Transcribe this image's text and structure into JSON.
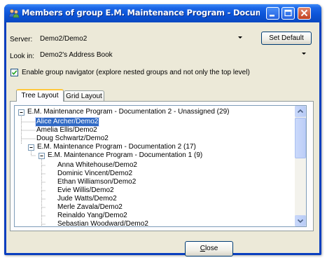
{
  "window": {
    "title": "Members of group E.M. Maintenance Program - Documentation...",
    "app_icon": "group-icon",
    "controls": [
      "minimize-icon",
      "maximize-icon",
      "close-icon"
    ]
  },
  "server": {
    "label": "Server:",
    "value": "Demo2/Demo2",
    "button": "Set Default"
  },
  "lookin": {
    "label": "Look in:",
    "value": "Demo2's Address Book"
  },
  "navigator": {
    "checked": true,
    "label": "Enable group navigator (explore nested groups and not only the top level)"
  },
  "tabs": [
    {
      "label": "Tree Layout",
      "active": true
    },
    {
      "label": "Grid Layout",
      "active": false
    }
  ],
  "tree": [
    {
      "label": "E.M. Maintenance Program - Documentation 2 - Unassigned (29)",
      "type": "group",
      "expanded": true
    },
    {
      "label": "Alice Archer/Demo2",
      "type": "person",
      "selected": true
    },
    {
      "label": "Amelia Ellis/Demo2",
      "type": "person"
    },
    {
      "label": "Doug Schwartz/Demo2",
      "type": "person"
    },
    {
      "label": "E.M. Maintenance Program - Documentation 2 (17)",
      "type": "group",
      "expanded": true
    },
    {
      "label": "E.M. Maintenance Program - Documentation 1 (9)",
      "type": "group",
      "expanded": true
    },
    {
      "label": "Anna Whitehouse/Demo2",
      "type": "person"
    },
    {
      "label": "Dominic Vincent/Demo2",
      "type": "person"
    },
    {
      "label": "Ethan Williamson/Demo2",
      "type": "person"
    },
    {
      "label": "Evie Willis/Demo2",
      "type": "person"
    },
    {
      "label": "Jude Watts/Demo2",
      "type": "person"
    },
    {
      "label": "Merle Zavala/Demo2",
      "type": "person"
    },
    {
      "label": "Reinaldo Yang/Demo2",
      "type": "person"
    },
    {
      "label": "Sebastian Woodward/Demo2",
      "type": "person"
    }
  ],
  "footer": {
    "close_accel": "C",
    "close_rest": "lose"
  },
  "colors": {
    "selection": "#316ac5",
    "title_bar": "#0c55d9",
    "dialog_bg": "#ece9d8"
  }
}
